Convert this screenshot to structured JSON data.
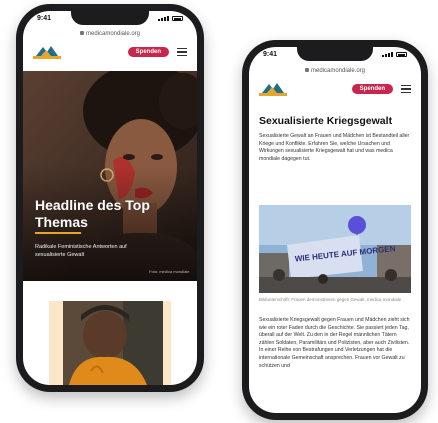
{
  "left_phone": {
    "status_time": "9:41",
    "url": "medicamondiale.org",
    "donate_label": "Spenden",
    "hero_title": "Headline des Top Themas",
    "hero_subtitle": "Radikale Feministische Antworten auf sexualisierte Gewalt",
    "hero_credit": "Foto: medica mondiale"
  },
  "right_phone": {
    "status_time": "9:41",
    "url": "medicamondiale.org",
    "donate_label": "Spenden",
    "article_title": "Sexualisierte Kriegsgewalt",
    "intro": "Sexualisierte Gewalt an Frauen und Mädchen ist Bestandteil aller Kriege und Konflikte. Erfahren Sie, welche Ursachen und Wirkungen sexualisierte Kriegsgewalt hat und was medica mondiale dagegen tut.",
    "photo_banner": "WIE HEUTE AUF MORGEN",
    "photo_caption": "Bildunterschrift: Frauen demonstrieren gegen Gewalt, medica mondiale",
    "body": "Sexualisierte Kriegsgewalt gegen Frauen und Mädchen zieht sich wie ein roter Faden durch die Geschichte. Sie passiert jeden Tag, überall auf der Welt. Zu den in der Regel männlichen Tätern zählen Soldaten, Paramilitärs und Polizisten, aber auch Zivilisten. In einer Reihe von Bestrafungen und Verletzungen hat die internationale Gemeinschaft ansprechen. Frauen vor Gewalt zu schützen und"
  },
  "colors": {
    "accent_red": "#c8264d",
    "underline_gold": "#e6a52c",
    "phone_frame": "#1c1c1e"
  }
}
